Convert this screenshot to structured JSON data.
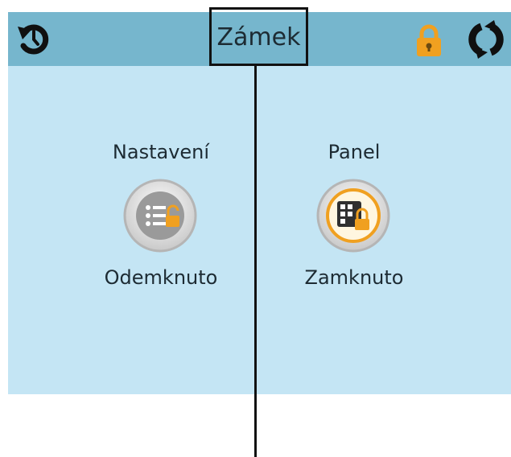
{
  "header": {
    "title": "Zámek",
    "back_icon": "back-rotate-icon",
    "lock_icon": "padlock-icon",
    "refresh_icon": "refresh-icon"
  },
  "items": [
    {
      "label": "Nastavení",
      "status": "Odemknuto",
      "icon": "settings-unlocked-icon"
    },
    {
      "label": "Panel",
      "status": "Zamknuto",
      "icon": "panel-locked-icon"
    }
  ],
  "colors": {
    "topbar": "#76b6cd",
    "screen": "#c4e5f4",
    "lock_accent": "#f0a020"
  }
}
